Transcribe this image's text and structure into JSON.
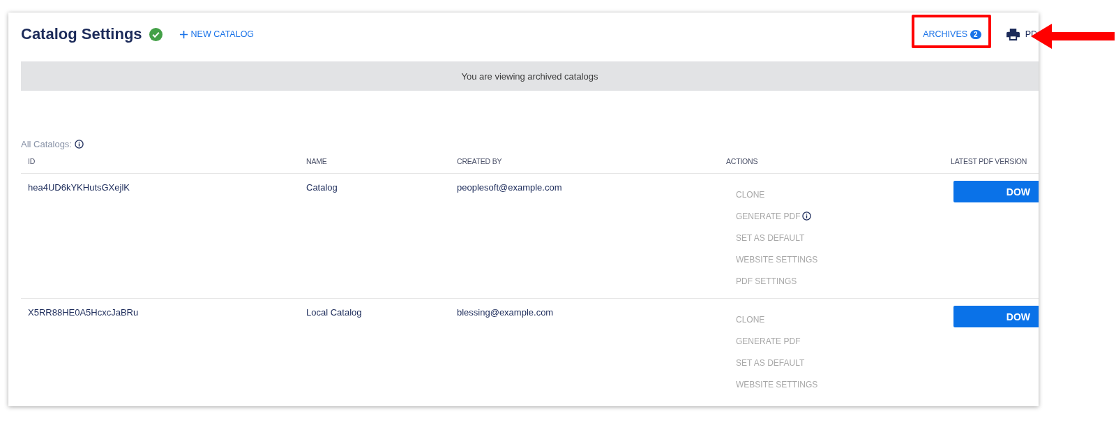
{
  "header": {
    "title": "Catalog Settings",
    "saved": true,
    "new_button": "NEW CATALOG",
    "archives": {
      "label": "ARCHIVES",
      "count": "2"
    },
    "print_label": "PD"
  },
  "banner": "You are viewing archived catalogs",
  "table": {
    "caption": "All Catalogs:",
    "columns": [
      "ID",
      "NAME",
      "CREATED BY",
      "ACTIONS",
      "LATEST PDF VERSION"
    ],
    "rows": [
      {
        "id": "hea4UD6kYKHutsGXejlK",
        "name": "Catalog",
        "created_by": "peoplesoft@example.com",
        "actions": [
          {
            "label": "CLONE",
            "disabled": true,
            "info": false
          },
          {
            "label": "GENERATE PDF",
            "disabled": true,
            "info": true
          },
          {
            "label": "SET AS DEFAULT",
            "disabled": true,
            "info": false
          },
          {
            "label": "WEBSITE SETTINGS",
            "disabled": true,
            "info": false
          },
          {
            "label": "PDF SETTINGS",
            "disabled": true,
            "info": false
          }
        ],
        "download": "DOW"
      },
      {
        "id": "X5RR88HE0A5HcxcJaBRu",
        "name": "Local Catalog",
        "created_by": "blessing@example.com",
        "actions": [
          {
            "label": "CLONE",
            "disabled": true,
            "info": false
          },
          {
            "label": "GENERATE PDF",
            "disabled": true,
            "info": false
          },
          {
            "label": "SET AS DEFAULT",
            "disabled": true,
            "info": false
          },
          {
            "label": "WEBSITE SETTINGS",
            "disabled": true,
            "info": false
          }
        ],
        "download": "DOW"
      }
    ]
  }
}
